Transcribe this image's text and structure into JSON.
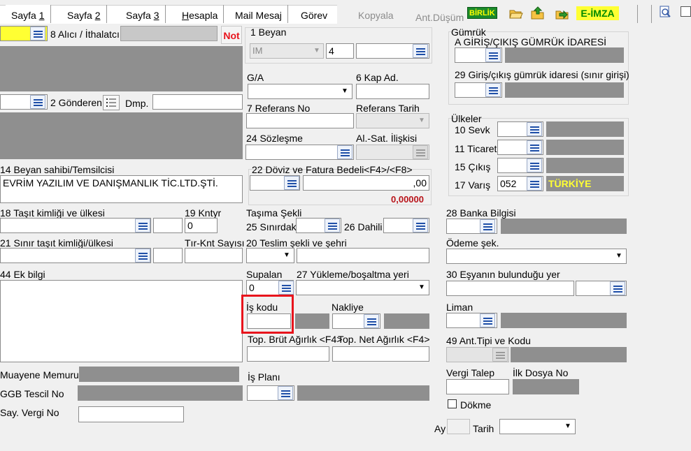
{
  "tabs": [
    {
      "pre": "Sayfa ",
      "u": "1",
      "post": ""
    },
    {
      "pre": "Sayfa ",
      "u": "2",
      "post": ""
    },
    {
      "pre": "Sayfa ",
      "u": "3",
      "post": ""
    },
    {
      "pre": "",
      "u": "H",
      "post": "esapla"
    },
    {
      "pre": "Mail Mesaj",
      "u": "",
      "post": ""
    },
    {
      "pre": "Görev",
      "u": "",
      "post": ""
    }
  ],
  "toolbar": {
    "kopyala": "Kopyala",
    "ant_dusum": "Ant.Düşüm",
    "birlik": "BİRLİK",
    "eimza": "E-İMZA"
  },
  "left": {
    "alici_label": "8 Alıcı / İthalatcı",
    "not_label": "Not",
    "gonderen_label": "2 Gönderen",
    "dmp_label": "Dmp.",
    "beyan_sahibi_label": "14 Beyan sahibi/Temsilcisi",
    "beyan_sahibi_value": "EVRİM YAZILIM VE DANIŞMANLIK TİC.LTD.ŞTİ.",
    "tasit_label": "18 Taşıt kimliği ve ülkesi",
    "kntyr_label": "19 Kntyr",
    "kntyr_value": "0",
    "sinir_tasit_label": "21 Sınır taşıt kimliği/ülkesi",
    "tir_label": "Tır-Knt Sayısı",
    "ek_bilgi_label": "44 Ek bilgi",
    "muayene_label": "Muayene Memuru",
    "ggb_label": "GGB Tescil No",
    "vergi_label": "Say. Vergi No"
  },
  "mid": {
    "beyan_label": "1 Beyan",
    "beyan_type": "IM",
    "beyan_no": "4",
    "ga_label": "G/A",
    "kap_label": "6 Kap Ad.",
    "ref_label": "7 Referans No",
    "ref_tarih_label": "Referans Tarih",
    "sozlesme_label": "24 Sözleşme",
    "alsat_label": "Al.-Sat. İlişkisi",
    "doviz_label": "22 Döviz ve Fatura Bedeli<F4>/<F8>",
    "doviz_value": ",00",
    "doviz_total": "0,00000",
    "tasima_label": "Taşıma Şekli",
    "sinirdaki_label": "25 Sınırdaki",
    "dahili_label": "26 Dahili",
    "teslim_label": "20 Teslim şekli ve şehri",
    "supalan_label": "Supalan",
    "supalan_value": "0",
    "yukleme_label": "27 Yükleme/boşaltma yeri",
    "iskodu_label": "İş kodu",
    "nakliye_label": "Nakliye",
    "brut_label": "Top. Brüt Ağırlık <F4>",
    "net_label": "Top. Net Ağırlık <F4>",
    "isplani_label": "İş Planı"
  },
  "right": {
    "gumruk_label": "Gümrük",
    "giris_cikis_label": "A GİRİŞ/ÇIKIŞ GÜMRÜK İDARESİ",
    "sinir_girisi_label": "29 Giriş/çıkış gümrük idaresi (sınır girişi)",
    "ulkeler_label": "Ülkeler",
    "sevk_label": "10 Sevk",
    "ticaret_label": "11 Ticaret",
    "cikis_label": "15 Çıkış",
    "varis_label": "17 Varış",
    "varis_code": "052",
    "varis_name": "TÜRKİYE",
    "banka_label": "28 Banka Bilgisi",
    "odeme_label": "Ödeme şek.",
    "esya_label": "30 Eşyanın bulunduğu yer",
    "liman_label": "Liman",
    "ant_tipi_label": "49 Ant.Tipi ve Kodu",
    "vergi_talep_label": "Vergi Talep",
    "ilk_dosya_label": "İlk Dosya No",
    "dokme_label": "Dökme",
    "ay_label": "Ay",
    "tarih_label": "Tarih"
  },
  "colors": {
    "highlight_red": "#e8141c",
    "yellow": "#ffff33",
    "gray_field": "#8f8f8f",
    "birlik_bg": "#1a8a2a",
    "eimza_bg": "#ffff33"
  }
}
